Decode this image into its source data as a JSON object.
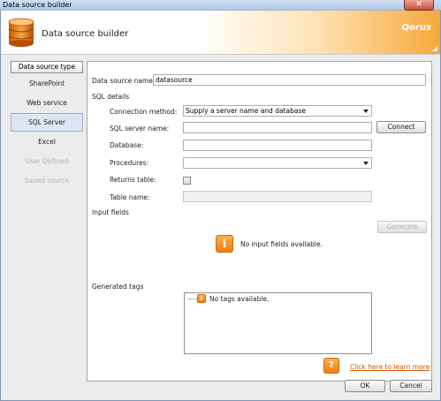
{
  "window": {
    "title": "Data source builder",
    "close_glyph": "✕"
  },
  "header": {
    "title": "Data source builder",
    "brand": "Qorus"
  },
  "sidebar": {
    "header": "Data source type",
    "items": [
      {
        "label": "SharePoint",
        "state": "normal"
      },
      {
        "label": "Web service",
        "state": "normal"
      },
      {
        "label": "SQL Server",
        "state": "selected"
      },
      {
        "label": "Excel",
        "state": "normal"
      },
      {
        "label": "User Defined",
        "state": "disabled"
      },
      {
        "label": "Saved source",
        "state": "disabled"
      }
    ]
  },
  "form": {
    "data_source_name_label": "Data source name:",
    "data_source_name_value": "datasource",
    "sql_details_label": "SQL details",
    "connection_method_label": "Connection method:",
    "connection_method_value": "Supply a server name and database",
    "sql_server_name_label": "SQL server name:",
    "sql_server_name_value": "",
    "connect_label": "Connect",
    "database_label": "Database:",
    "database_value": "",
    "procedures_label": "Procedures:",
    "procedures_value": "",
    "returns_table_label": "Returns table:",
    "returns_table_checked": false,
    "table_name_label": "Table name:",
    "table_name_value": ""
  },
  "input_fields": {
    "label": "Input fields",
    "generate_label": "Generate",
    "empty_message": "No input fields available.",
    "icon_glyph": "i"
  },
  "generated_tags": {
    "label": "Generated tags",
    "empty_message": "No tags available.",
    "icon_glyph": "i"
  },
  "help": {
    "icon_glyph": "?",
    "link_text": "Click here to learn more"
  },
  "footer": {
    "ok_label": "OK",
    "cancel_label": "Cancel"
  },
  "colors": {
    "accent": "#ef7d12",
    "selection": "#dce6f2",
    "link": "#cc5500"
  }
}
